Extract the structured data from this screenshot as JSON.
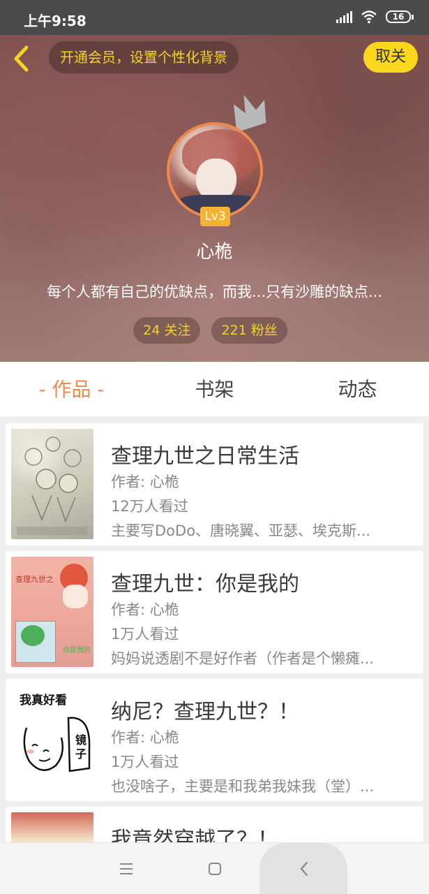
{
  "status_bar": {
    "time": "上午9:58",
    "battery": "16",
    "icons": [
      "signal-icon",
      "wifi-icon",
      "battery-icon"
    ]
  },
  "header": {
    "back_icon": "chevron-left-icon",
    "vip_banner": "开通会员，设置个性化背景",
    "follow_button": "取关",
    "level": "Lv3",
    "username": "心桅",
    "bio": "每个人都有自己的优缺点，而我...只有沙雕的缺点...",
    "following": "24 关注",
    "followers": "221 粉丝"
  },
  "tabs": [
    {
      "label": "- 作品 -",
      "active": true
    },
    {
      "label": "书架",
      "active": false
    },
    {
      "label": "动态",
      "active": false
    }
  ],
  "works": [
    {
      "title": "查理九世之日常生活",
      "author": "作者: 心桅",
      "views": "12万人看过",
      "description": "主要写DoDo、唐晓翼、亚瑟、埃克斯..."
    },
    {
      "title": "查理九世：你是我的",
      "author": "作者: 心桅",
      "views": "1万人看过",
      "description": "妈妈说透剧不是好作者（作者是个懒瘫..."
    },
    {
      "title": "纳尼？查理九世？！",
      "author": "作者: 心桅",
      "views": "1万人看过",
      "description": "也没啥子，主要是和我弟我妹我（堂）..."
    },
    {
      "title": "我竟然穿越了？！",
      "author": "",
      "views": "",
      "description": ""
    }
  ],
  "covers": {
    "cover2_text_top": "查理九世之",
    "cover2_text_bottom": "你是我的",
    "cover3_text_top": "我真好看",
    "cover3_text_mirror": "镜子"
  },
  "nav_bar": {
    "icons": [
      "menu-icon",
      "home-square-icon",
      "back-triangle-icon"
    ]
  },
  "colors": {
    "accent_orange": "#ee8a4e",
    "vip_yellow": "#f5d327",
    "follow_button_yellow": "#f9d71c",
    "level_badge": "#f3b331"
  }
}
